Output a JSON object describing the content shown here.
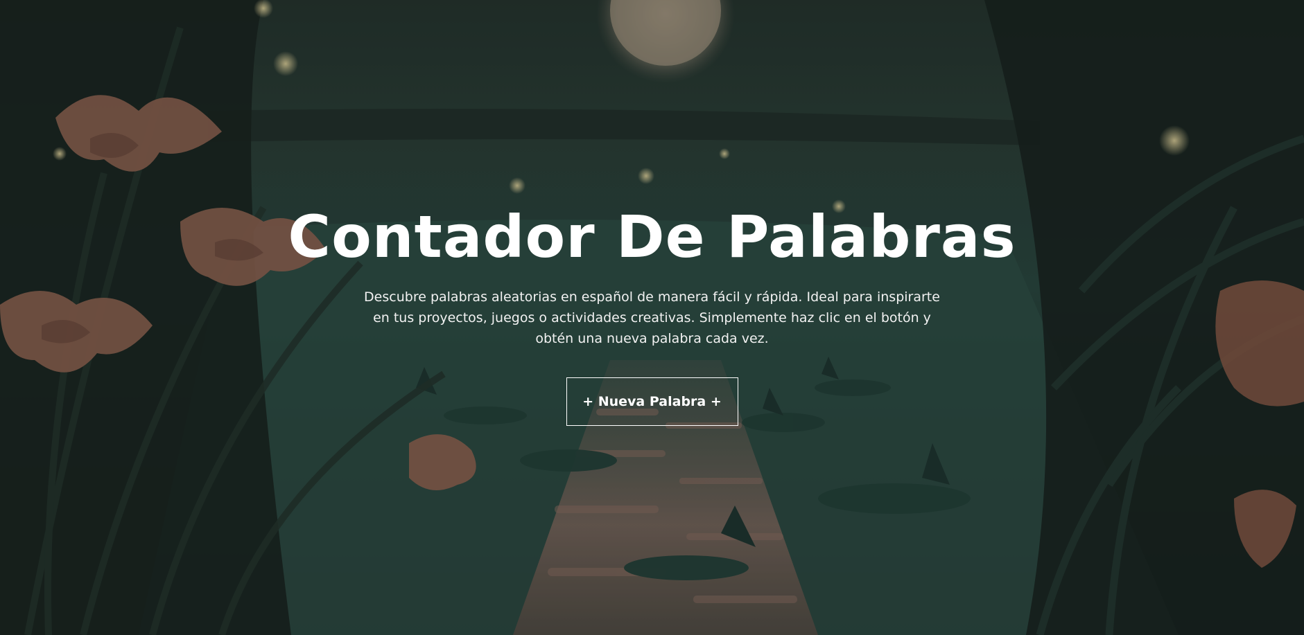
{
  "hero": {
    "title": "Contador De Palabras",
    "description": "Descubre palabras aleatorias en español de manera fácil y rápida. Ideal para inspirarte en tus proyectos, juegos o actividades creativas. Simplemente haz clic en el botón y obtén una nueva palabra cada vez.",
    "button_label": "+ Nueva Palabra +"
  },
  "background": {
    "scene": "night-pond-with-flowers",
    "colors": {
      "water": "#2c4a42",
      "foliage": "#1c2a24",
      "flowers": "#9a6a55",
      "moon": "#a89a86",
      "text": "#ffffff"
    }
  }
}
